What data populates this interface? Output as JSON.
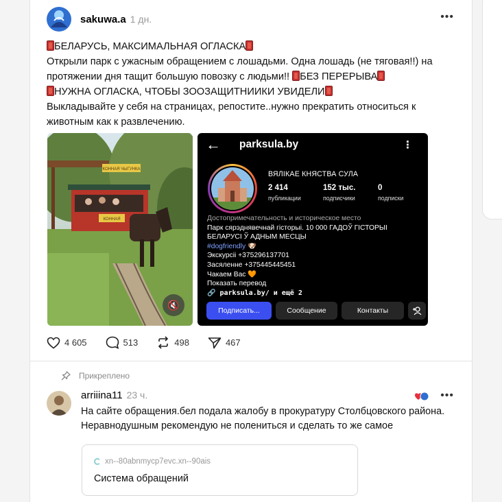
{
  "post": {
    "username": "sakuwa.a",
    "time": "1 дн.",
    "more_icon": "more-horizontal-icon",
    "text": {
      "line1": "БЕЛАРУСЬ, МАКСИМАЛЬНАЯ ОГЛАСКА",
      "line2": "Открыли парк с ужасным обращением с лошадьми. Одна лошадь (не тяговая!!) на протяжении дня тащит большую повозку с людьми!! ",
      "line2_emph": "БЕЗ ПЕРЕРЫВА",
      "line3": "НУЖНА ОГЛАСКА, ЧТОБЫ ЗООЗАЩИТНИИКИ УВИДЕЛИ",
      "line4": "Выкладывайте у себя на страницах, репостите..нужно прекратить относиться к животным как к развлечению."
    },
    "photo": {
      "sign_top": "КОННАЯ ЧЫГУНКА",
      "sign_side": "КОННАЯ",
      "mute_icon": "volume-mute-icon"
    },
    "instagram": {
      "back_icon": "arrow-left-icon",
      "handle": "parksula.by",
      "menu_icon": "more-vertical-icon",
      "name": "ВЯЛІКАЕ КНЯСТВА СУЛА",
      "stats": [
        {
          "num": "2 414",
          "label": "публикации"
        },
        {
          "num": "152 тыс.",
          "label": "подписчики"
        },
        {
          "num": "0",
          "label": "подписки"
        }
      ],
      "category": "Достопримечательность и историческое место",
      "bio1": "Парк сярэднявечнай гісторыі. 10 000 ГАДОЎ ГІСТОРЫІ",
      "bio2": "БЕЛАРУСІ Ў АДНЫМ МЕСЦЫ",
      "hashtag": "#dogfriendly 🐶",
      "excursions": "Экскурсіі +375296137701",
      "settle": "Засяленне +375445445451",
      "waiting": "Чакаем Вас 🧡",
      "translate": "Показать перевод",
      "link": "parksula.by/ и ещё 2",
      "buttons": {
        "follow": "Подписать...",
        "message": "Сообщение",
        "contacts": "Контакты"
      },
      "add_user_icon": "add-user-icon"
    },
    "actions": {
      "likes": "4 605",
      "comments": "513",
      "reposts": "498",
      "shares": "467"
    }
  },
  "pinned_label": "Прикреплено",
  "reply": {
    "username": "arriiina11",
    "time": "23 ч.",
    "text": "На сайте обращения.бел подала жалобу в прокуратуру Столбцовского района. Неравнодушным рекомендую не полениться и сделать то же самое",
    "link_card": {
      "url": "xn--80abnmycp7evc.xn--90ais",
      "title": "Система обращений"
    }
  },
  "colors": {
    "follow_button": "#3b4ff0",
    "hashtag": "#7ea0ff",
    "muted_text": "#999999"
  }
}
